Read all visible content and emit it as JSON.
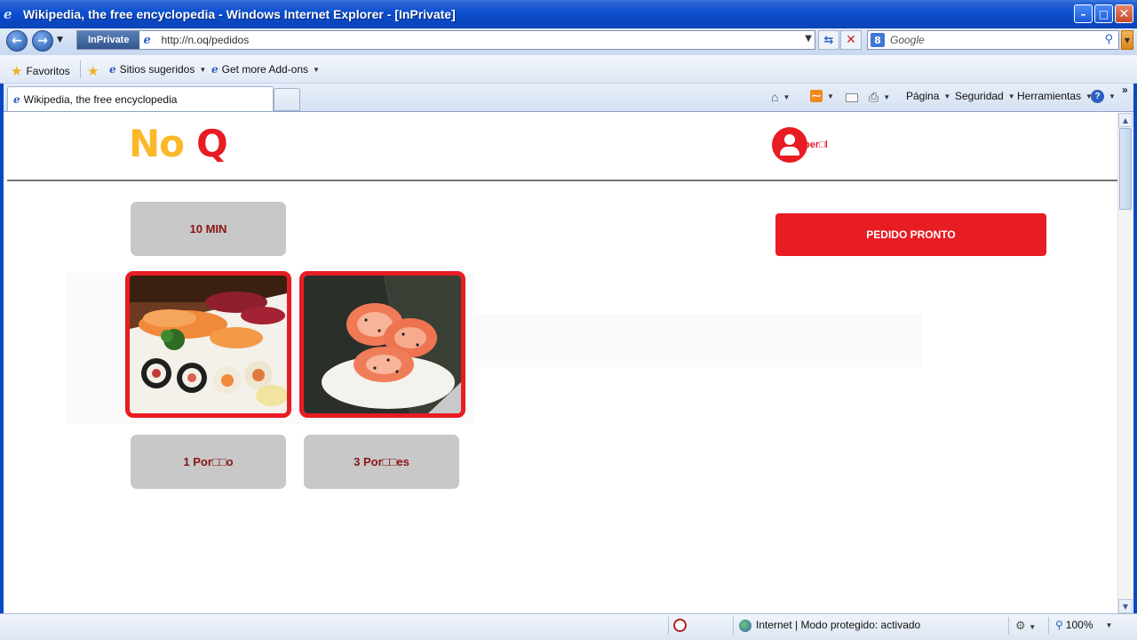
{
  "window": {
    "title": "Wikipedia, the free encyclopedia - Windows Internet Explorer - [InPrivate]",
    "minimize": "–",
    "maximize": "□",
    "close": "✕"
  },
  "nav": {
    "inprivate_label": "InPrivate",
    "url": "http://n.oq/pedidos",
    "search_placeholder": "Google",
    "icons": [
      "back-icon",
      "forward-icon",
      "refresh-icon",
      "stop-icon",
      "search-icon"
    ]
  },
  "favorites": {
    "favorites_label": "Favoritos",
    "items": [
      {
        "label": "Sitios sugeridos"
      },
      {
        "label": "Get more Add-ons"
      }
    ]
  },
  "tabs": {
    "active_label": "Wikipedia, the free encyclopedia"
  },
  "commandbar": {
    "page": "Página",
    "security": "Seguridad",
    "tools": "Herramientas",
    "chevrons": "»"
  },
  "site": {
    "logo_no": "No",
    "logo_q": "Q",
    "profile_label": "per□l",
    "time_button": "10 MIN",
    "ready_button": "PEDIDO PRONTO",
    "portions": [
      {
        "label": "1 Por□□o"
      },
      {
        "label": "3 Por□□es"
      }
    ],
    "brand_colors": {
      "yellow": "#fbb829",
      "red": "#e81c23",
      "button_gray": "#c8c8c8",
      "button_text": "#8a1414"
    }
  },
  "status": {
    "zone": "Internet | Modo protegido: activado",
    "zoom": "100%"
  }
}
